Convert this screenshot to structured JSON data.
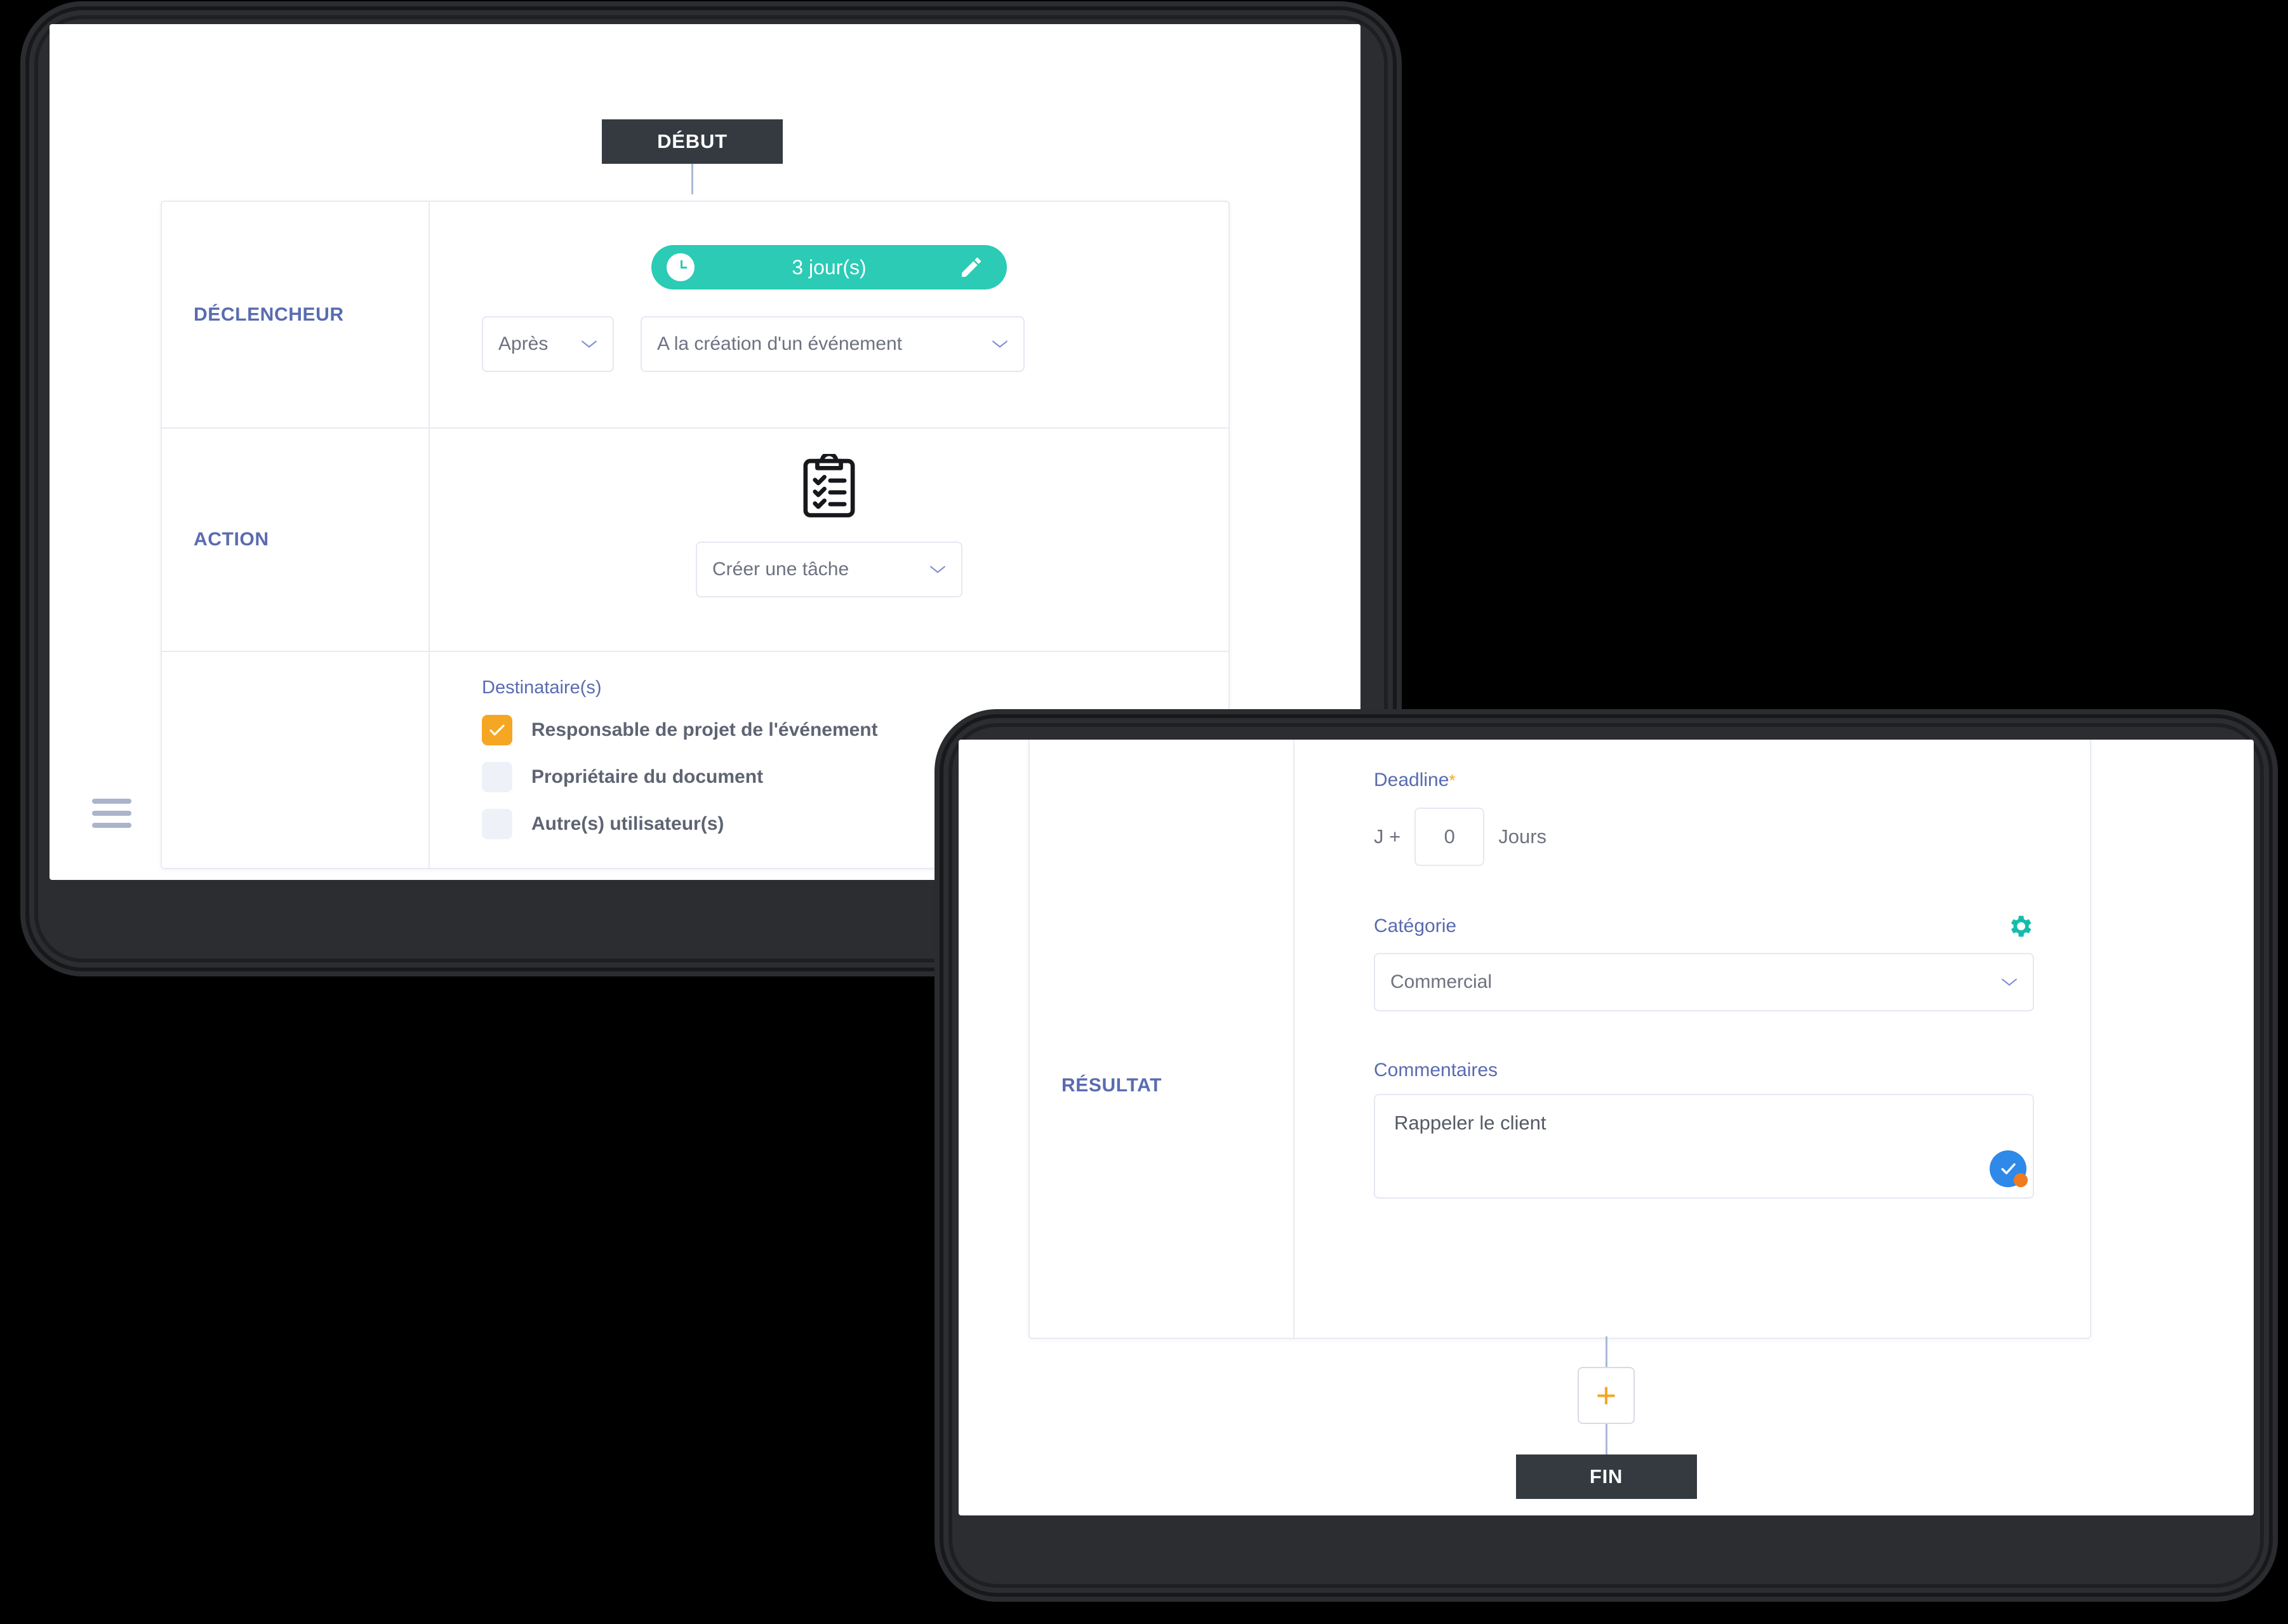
{
  "back_screen": {
    "menu_icon": "hamburger-icon",
    "start_node": "DÉBUT",
    "rows": [
      {
        "label": "DÉCLENCHEUR",
        "pill": {
          "icon": "clock-icon",
          "text": "3 jour(s)",
          "edit_icon": "pencil-icon"
        },
        "select_when": "Après",
        "select_event": "A la création d'un événement"
      },
      {
        "label": "ACTION",
        "icon": "clipboard-checklist-icon",
        "select_action": "Créer une tâche"
      }
    ],
    "recipients": {
      "title": "Destinataire(s)",
      "items": [
        {
          "label": "Responsable de projet de l'événement",
          "checked": true
        },
        {
          "label": "Propriétaire du document",
          "checked": false
        },
        {
          "label": "Autre(s) utilisateur(s)",
          "checked": false
        }
      ]
    }
  },
  "front_screen": {
    "result_label": "RÉSULTAT",
    "deadline": {
      "label": "Deadline",
      "required_mark": "*",
      "prefix": "J +",
      "value": "0",
      "suffix": "Jours"
    },
    "category": {
      "label": "Catégorie",
      "settings_icon": "gear-icon",
      "value": "Commercial"
    },
    "comments": {
      "label": "Commentaires",
      "value": "Rappeler le client",
      "badge_icon": "check-circle-icon"
    },
    "add_button": "+",
    "end_node": "FIN"
  },
  "colors": {
    "teal": "#2bcbb6",
    "orange": "#f5a623",
    "indigo": "#5a6bb0",
    "node_dark": "#343a40",
    "blue_badge": "#2f89e8"
  }
}
